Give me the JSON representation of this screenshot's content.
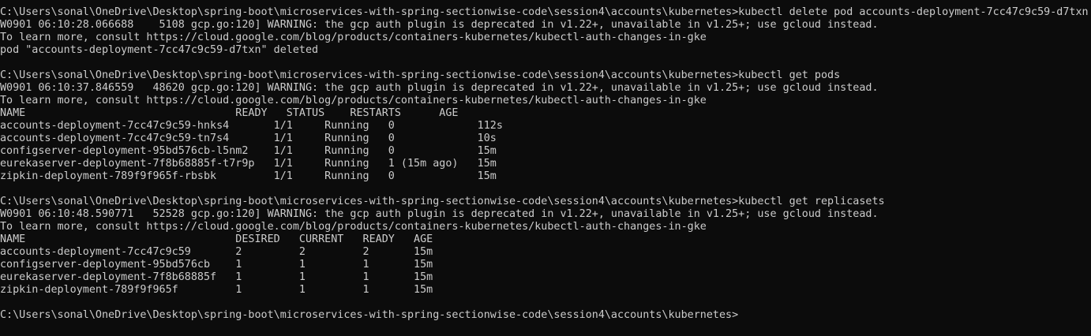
{
  "colors": {
    "background": "#0c0c0c",
    "foreground": "#cccccc"
  },
  "terminal": {
    "lines": [
      "C:\\Users\\sonal\\OneDrive\\Desktop\\spring-boot\\microservices-with-spring-sectionwise-code\\session4\\accounts\\kubernetes>kubectl delete pod accounts-deployment-7cc47c9c59-d7txn",
      "W0901 06:10:28.066688    5108 gcp.go:120] WARNING: the gcp auth plugin is deprecated in v1.22+, unavailable in v1.25+; use gcloud instead.",
      "To learn more, consult https://cloud.google.com/blog/products/containers-kubernetes/kubectl-auth-changes-in-gke",
      "pod \"accounts-deployment-7cc47c9c59-d7txn\" deleted",
      "",
      "C:\\Users\\sonal\\OneDrive\\Desktop\\spring-boot\\microservices-with-spring-sectionwise-code\\session4\\accounts\\kubernetes>kubectl get pods",
      "W0901 06:10:37.846559   48620 gcp.go:120] WARNING: the gcp auth plugin is deprecated in v1.22+, unavailable in v1.25+; use gcloud instead.",
      "To learn more, consult https://cloud.google.com/blog/products/containers-kubernetes/kubectl-auth-changes-in-gke",
      "NAME                                 READY   STATUS    RESTARTS      AGE",
      "accounts-deployment-7cc47c9c59-hnks4       1/1     Running   0             112s",
      "accounts-deployment-7cc47c9c59-tn7s4       1/1     Running   0             10s",
      "configserver-deployment-95bd576cb-l5nm2    1/1     Running   0             15m",
      "eurekaserver-deployment-7f8b68885f-t7r9p   1/1     Running   1 (15m ago)   15m",
      "zipkin-deployment-789f9f965f-rbsbk         1/1     Running   0             15m",
      "",
      "C:\\Users\\sonal\\OneDrive\\Desktop\\spring-boot\\microservices-with-spring-sectionwise-code\\session4\\accounts\\kubernetes>kubectl get replicasets",
      "W0901 06:10:48.590771   52528 gcp.go:120] WARNING: the gcp auth plugin is deprecated in v1.22+, unavailable in v1.25+; use gcloud instead.",
      "To learn more, consult https://cloud.google.com/blog/products/containers-kubernetes/kubectl-auth-changes-in-gke",
      "NAME                                 DESIRED   CURRENT   READY   AGE",
      "accounts-deployment-7cc47c9c59       2         2         2       15m",
      "configserver-deployment-95bd576cb    1         1         1       15m",
      "eurekaserver-deployment-7f8b68885f   1         1         1       15m",
      "zipkin-deployment-789f9f965f         1         1         1       15m",
      "",
      "C:\\Users\\sonal\\OneDrive\\Desktop\\spring-boot\\microservices-with-spring-sectionwise-code\\session4\\accounts\\kubernetes>"
    ]
  }
}
